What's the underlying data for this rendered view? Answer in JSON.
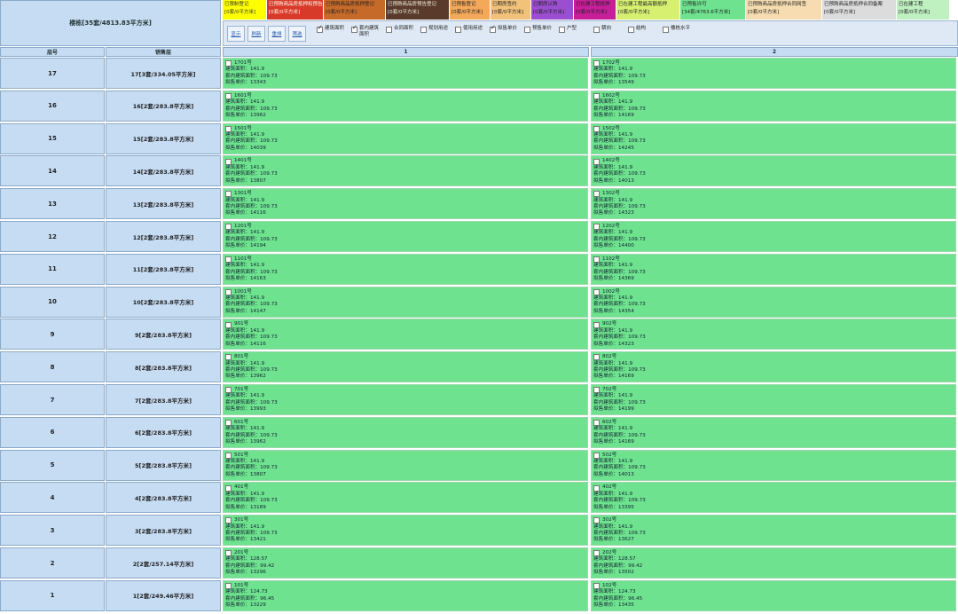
{
  "summary": "楼栋[35套/4813.83平方米]",
  "legend": [
    {
      "title": "已限制登记",
      "sub": "[0套/0平方米]",
      "bg": "#ffff00",
      "fg": "#333"
    },
    {
      "title": "已预购商品房抵押权预告登记",
      "sub": "[0套/0平方米]",
      "bg": "#d83a2a",
      "fg": "#ffe"
    },
    {
      "title": "已预购商品房抵押登记",
      "sub": "[0套/0平方米]",
      "bg": "#c66a2a",
      "fg": "#222"
    },
    {
      "title": "已预购商品房预告登记",
      "sub": "[0套/0平方米]",
      "bg": "#5a3a2a",
      "fg": "#eed"
    },
    {
      "title": "已预售登记",
      "sub": "[0套/0平方米]",
      "bg": "#f3a85a",
      "fg": "#222"
    },
    {
      "title": "已期房签约",
      "sub": "[0套/0平方米]",
      "bg": "#f2c27a",
      "fg": "#222"
    },
    {
      "title": "已期房认购",
      "sub": "[0套/0平方米]",
      "bg": "#9b4fd0",
      "fg": "#222"
    },
    {
      "title": "已在建工程抵押",
      "sub": "[0套/0平方米]",
      "bg": "#c81e9a",
      "fg": "#222"
    },
    {
      "title": "已在建工程最高额抵押",
      "sub": "[0套/0平方米]",
      "bg": "#d7f070",
      "fg": "#222"
    },
    {
      "title": "已预售许可",
      "sub": "[34套/4763.6平方米]",
      "bg": "#6ee28e",
      "fg": "#222"
    },
    {
      "title": "已预购商品房抵押合同网签",
      "sub": "[0套/0平方米]",
      "bg": "#f6dcb0",
      "fg": "#222"
    },
    {
      "title": "已预购商品房抵押合同备案",
      "sub": "[0套/0平方米]",
      "bg": "#dcdcdc",
      "fg": "#222"
    },
    {
      "title": "已在建工程",
      "sub": "[0套/0平方米]",
      "bg": "#bff0c0",
      "fg": "#222"
    }
  ],
  "toolbar": {
    "buttons": [
      "显示",
      "刷新",
      "重排",
      "筛选"
    ],
    "options": [
      {
        "label": "建筑面积",
        "checked": true
      },
      {
        "label": "套内建筑面积",
        "checked": true
      },
      {
        "label": "合同面积",
        "checked": false
      },
      {
        "label": "规划用途",
        "checked": false
      },
      {
        "label": "使用用途",
        "checked": false
      },
      {
        "label": "拟售单价",
        "checked": true
      },
      {
        "label": "预售单价",
        "checked": false
      },
      {
        "label": "户型",
        "checked": false
      },
      {
        "label": "朝向",
        "checked": false
      },
      {
        "label": "结构",
        "checked": false
      },
      {
        "label": "楼栋水平",
        "checked": false
      }
    ]
  },
  "columns": {
    "floor": "层号",
    "sold": "销售层",
    "unit1": "1",
    "unit2": "2"
  },
  "labels": {
    "area": "建筑面积：",
    "inner": "套内建筑面积：",
    "price": "拟售单价："
  },
  "rows": [
    {
      "floor": "17",
      "sold": "17[3套/334.05平方米]",
      "u1": {
        "no": "1701号",
        "area": "141.9",
        "inner": "109.73",
        "price": "13343"
      },
      "u2": {
        "no": "1702号",
        "area": "141.9",
        "inner": "109.73",
        "price": "13549"
      }
    },
    {
      "floor": "16",
      "sold": "16[2套/283.8平方米]",
      "u1": {
        "no": "1601号",
        "area": "141.9",
        "inner": "109.73",
        "price": "13962"
      },
      "u2": {
        "no": "1602号",
        "area": "141.9",
        "inner": "109.73",
        "price": "14169"
      }
    },
    {
      "floor": "15",
      "sold": "15[2套/283.8平方米]",
      "u1": {
        "no": "1501号",
        "area": "141.9",
        "inner": "109.73",
        "price": "14039"
      },
      "u2": {
        "no": "1502号",
        "area": "141.9",
        "inner": "109.73",
        "price": "14245"
      }
    },
    {
      "floor": "14",
      "sold": "14[2套/283.8平方米]",
      "u1": {
        "no": "1401号",
        "area": "141.9",
        "inner": "109.73",
        "price": "13807"
      },
      "u2": {
        "no": "1402号",
        "area": "141.9",
        "inner": "109.73",
        "price": "14013"
      }
    },
    {
      "floor": "13",
      "sold": "13[2套/283.8平方米]",
      "u1": {
        "no": "1301号",
        "area": "141.9",
        "inner": "109.73",
        "price": "14116"
      },
      "u2": {
        "no": "1302号",
        "area": "141.9",
        "inner": "109.73",
        "price": "14323"
      }
    },
    {
      "floor": "12",
      "sold": "12[2套/283.8平方米]",
      "u1": {
        "no": "1201号",
        "area": "141.9",
        "inner": "109.73",
        "price": "14194"
      },
      "u2": {
        "no": "1202号",
        "area": "141.9",
        "inner": "109.73",
        "price": "14400"
      }
    },
    {
      "floor": "11",
      "sold": "11[2套/283.8平方米]",
      "u1": {
        "no": "1101号",
        "area": "141.9",
        "inner": "109.73",
        "price": "14163"
      },
      "u2": {
        "no": "1102号",
        "area": "141.9",
        "inner": "109.73",
        "price": "14369"
      }
    },
    {
      "floor": "10",
      "sold": "10[2套/283.8平方米]",
      "u1": {
        "no": "1001号",
        "area": "141.9",
        "inner": "109.73",
        "price": "14147"
      },
      "u2": {
        "no": "1002号",
        "area": "141.9",
        "inner": "109.73",
        "price": "14354"
      }
    },
    {
      "floor": "9",
      "sold": "9[2套/283.8平方米]",
      "u1": {
        "no": "901号",
        "area": "141.9",
        "inner": "109.73",
        "price": "14116"
      },
      "u2": {
        "no": "902号",
        "area": "141.9",
        "inner": "109.73",
        "price": "14323"
      }
    },
    {
      "floor": "8",
      "sold": "8[2套/283.8平方米]",
      "u1": {
        "no": "801号",
        "area": "141.9",
        "inner": "109.73",
        "price": "13962"
      },
      "u2": {
        "no": "802号",
        "area": "141.9",
        "inner": "109.73",
        "price": "14169"
      }
    },
    {
      "floor": "7",
      "sold": "7[2套/283.8平方米]",
      "u1": {
        "no": "701号",
        "area": "141.9",
        "inner": "109.73",
        "price": "13993"
      },
      "u2": {
        "no": "702号",
        "area": "141.9",
        "inner": "109.73",
        "price": "14199"
      }
    },
    {
      "floor": "6",
      "sold": "6[2套/283.8平方米]",
      "u1": {
        "no": "601号",
        "area": "141.9",
        "inner": "109.73",
        "price": "13962"
      },
      "u2": {
        "no": "602号",
        "area": "141.9",
        "inner": "109.73",
        "price": "14169"
      }
    },
    {
      "floor": "5",
      "sold": "5[2套/283.8平方米]",
      "u1": {
        "no": "501号",
        "area": "141.9",
        "inner": "109.73",
        "price": "13807"
      },
      "u2": {
        "no": "502号",
        "area": "141.9",
        "inner": "109.73",
        "price": "14013"
      }
    },
    {
      "floor": "4",
      "sold": "4[2套/283.8平方米]",
      "u1": {
        "no": "401号",
        "area": "141.9",
        "inner": "109.73",
        "price": "13189"
      },
      "u2": {
        "no": "402号",
        "area": "141.9",
        "inner": "109.73",
        "price": "13395"
      }
    },
    {
      "floor": "3",
      "sold": "3[2套/283.8平方米]",
      "u1": {
        "no": "301号",
        "area": "141.9",
        "inner": "109.73",
        "price": "13421"
      },
      "u2": {
        "no": "302号",
        "area": "141.9",
        "inner": "109.73",
        "price": "13627"
      }
    },
    {
      "floor": "2",
      "sold": "2[2套/257.14平方米]",
      "u1": {
        "no": "201号",
        "area": "128.57",
        "inner": "99.42",
        "price": "13296"
      },
      "u2": {
        "no": "202号",
        "area": "128.57",
        "inner": "99.42",
        "price": "13502"
      }
    },
    {
      "floor": "1",
      "sold": "1[2套/249.46平方米]",
      "u1": {
        "no": "101号",
        "area": "124.73",
        "inner": "96.45",
        "price": "13229"
      },
      "u2": {
        "no": "102号",
        "area": "124.73",
        "inner": "96.45",
        "price": "13435"
      }
    }
  ]
}
